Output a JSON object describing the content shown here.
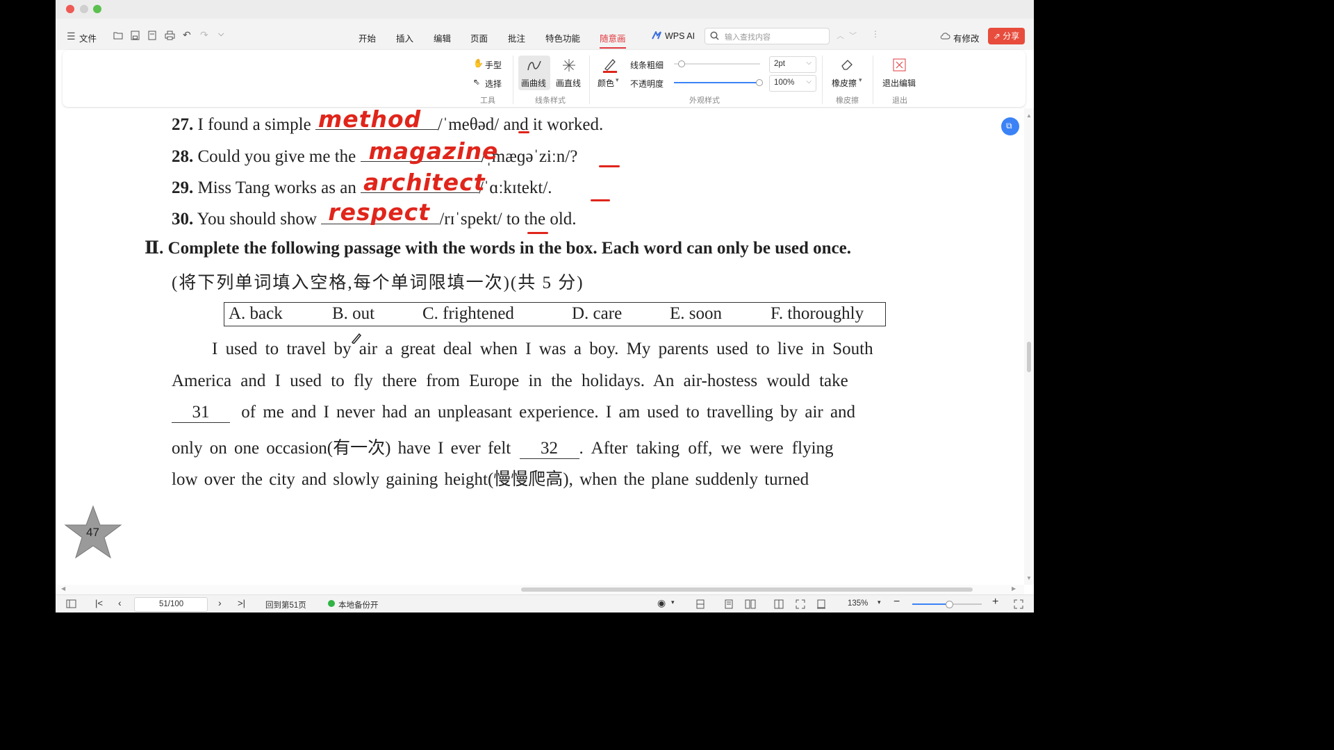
{
  "colors": {
    "accent": "#e0383e",
    "annotation": "#e0251b",
    "share_bg": "#e74c3c"
  },
  "menu": {
    "file": "文件",
    "tabs": [
      "开始",
      "插入",
      "编辑",
      "页面",
      "批注",
      "特色功能",
      "随意画"
    ],
    "active_tab": "随意画",
    "wps_ai": "WPS AI",
    "search_placeholder": "输入查找内容",
    "modified": "有修改",
    "share": "分享"
  },
  "ribbon": {
    "hand": "手型",
    "select": "选择",
    "tools_group": "工具",
    "curve": "画曲线",
    "straight": "画直线",
    "line_style_group": "线条样式",
    "color": "颜色",
    "line_width_label": "线条粗细",
    "line_width_value": "2pt",
    "opacity_label": "不透明度",
    "opacity_value": "100%",
    "appearance_group": "外观样式",
    "eraser": "橡皮擦",
    "eraser_group": "橡皮擦",
    "exit_edit": "退出编辑",
    "exit_group": "退出"
  },
  "document": {
    "q27": {
      "num": "27.",
      "before": "I found a simple",
      "answer": "method",
      "after": "/ˈmeθəd/ and it worked."
    },
    "q28": {
      "num": "28.",
      "before": "Could you give me the",
      "answer": "magazine",
      "after": "/ˌmæɡəˈziːn/?"
    },
    "q29": {
      "num": "29.",
      "before": "Miss Tang works as an",
      "answer": "architect",
      "after": "/ˈɑːkɪtekt/."
    },
    "q30": {
      "num": "30.",
      "before": "You should show",
      "answer": "respect",
      "after": "/rɪˈspekt/ to the old."
    },
    "section": {
      "mark": "Ⅱ.",
      "title": "Complete the following passage with the words in the box. Each word can only be used once.",
      "subtitle": "(将下列单词填入空格,每个单词限填一次)(共 5 分)"
    },
    "word_box": [
      "A. back",
      "B. out",
      "C. frightened",
      "D. care",
      "E. soon",
      "F. thoroughly"
    ],
    "passage": {
      "l1": "I used to travel by air a great deal when I was a boy. My parents used to live in South",
      "l2": "America and I used to fly there from Europe in the holidays. An air-hostess would take",
      "blank31": "31",
      "l3": "of me and I never had an unpleasant experience. I am used to travelling by air and",
      "l4a": "only on one occasion(有一次) have I ever felt",
      "blank32": "32",
      "l4b": ". After taking off, we were flying",
      "l5": "low over the city and slowly gaining height(慢慢爬高), when the plane suddenly turned"
    },
    "page_badge": "47"
  },
  "status": {
    "page_value": "51/100",
    "goto": "回到第51页",
    "backup": "本地备份开",
    "zoom": "135%"
  }
}
